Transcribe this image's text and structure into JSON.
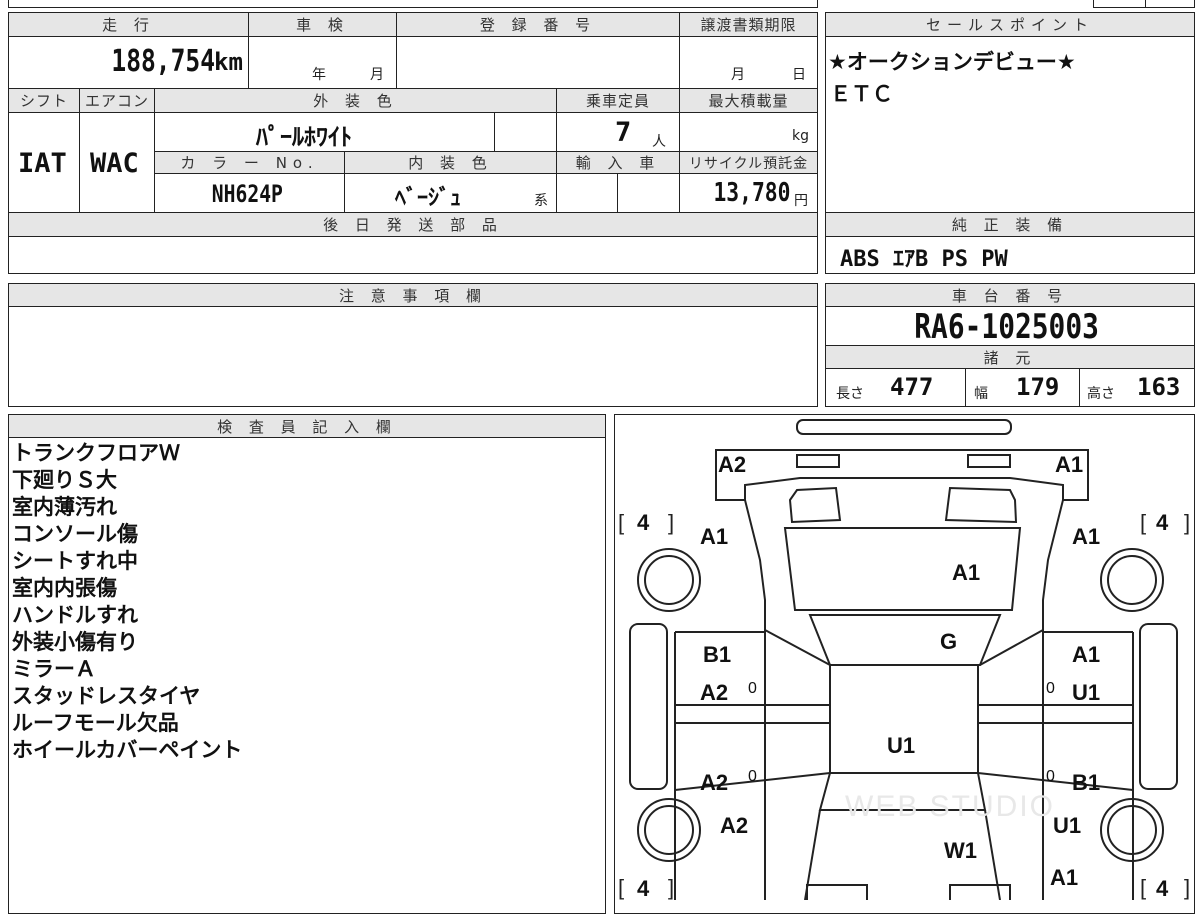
{
  "top": {
    "mileage_header": "走 行",
    "shaken_header": "車 検",
    "registration_header": "登 録 番 号",
    "transfer_header": "譲渡書類期限",
    "mileage_value": "188,754",
    "mileage_unit": "km",
    "shaken_year_unit": "年",
    "shaken_month_unit": "月",
    "transfer_month_unit": "月",
    "transfer_day_unit": "日"
  },
  "specs": {
    "shift_header": "シフト",
    "ac_header": "エアコン",
    "exterior_header": "外 装 色",
    "capacity_header": "乗車定員",
    "max_load_header": "最大積載量",
    "shift_value": "IAT",
    "ac_value": "WAC",
    "exterior_value": "ﾊﾟｰﾙﾎﾜｲﾄ",
    "capacity_value": "7",
    "capacity_unit": "人",
    "max_load_unit": "kg",
    "color_no_header": "カ ラ ー No.",
    "interior_header": "内 装 色",
    "import_header": "輸 入 車",
    "recycle_header": "リサイクル預託金",
    "color_no_value": "NH624P",
    "interior_value": "ﾍﾞｰｼﾞｭ",
    "interior_suffix": "系",
    "recycle_value": "13,780",
    "recycle_unit": "円"
  },
  "later_parts": {
    "header": "後 日 発 送 部 品",
    "value": ""
  },
  "notices": {
    "header": "注 意 事 項 欄",
    "value": ""
  },
  "sales_points": {
    "header": "セールスポイント",
    "lines": [
      "★オークションデビュー★",
      "ＥＴＣ"
    ]
  },
  "equipment": {
    "header": "純 正 装 備",
    "value": "ABS ｴｱB PS PW"
  },
  "chassis": {
    "header": "車 台 番 号",
    "value": "RA6-1025003"
  },
  "dimensions": {
    "header": "諸 元",
    "length_label": "長さ",
    "length_value": "477",
    "width_label": "幅",
    "width_value": "179",
    "height_label": "高さ",
    "height_value": "163"
  },
  "inspector": {
    "header": "検 査 員 記 入 欄",
    "notes": [
      "トランクフロアＷ",
      "下廻りＳ大",
      "室内薄汚れ",
      "コンソール傷",
      "シートすれ中",
      "室内内張傷",
      "ハンドルすれ",
      "外装小傷有り",
      "ミラーＡ",
      "スタッドレスタイヤ",
      "ルーフモール欠品",
      "ホイールカバーペイント"
    ]
  },
  "damage_marks": {
    "rear_left": "A2",
    "rear_right": "A1",
    "rear_quarter_left": "A1",
    "rear_quarter_right": "A1",
    "rear_glass": "A1",
    "roof": "G",
    "rear_door_left": "B1",
    "rear_door_right": "A1",
    "rear_door_left_2": "A2",
    "rear_door_right_2": "U1",
    "center": "U1",
    "front_door_left": "A2",
    "front_door_right": "B1",
    "front_fender_left": "A2",
    "front_fender_right": "U1",
    "windshield": "W1",
    "front_right": "A1",
    "tire_rl": "4",
    "tire_rr": "4",
    "tire_fl": "4",
    "tire_fr": "4",
    "zero_marks": [
      "0",
      "0",
      "0",
      "0"
    ]
  },
  "watermark": "WEB STUDIO"
}
